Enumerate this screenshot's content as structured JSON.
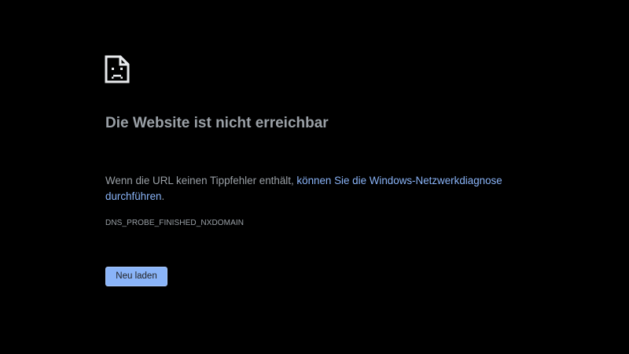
{
  "error": {
    "icon": "sad-document-icon",
    "title": "Die Website ist nicht erreichbar",
    "message_prefix": "Wenn die URL keinen Tippfehler enthält, ",
    "diagnose_link": "können Sie die Windows-Netzwerkdiagnose durchführen",
    "message_suffix": ".",
    "code": "DNS_PROBE_FINISHED_NXDOMAIN"
  },
  "actions": {
    "reload_label": "Neu laden"
  },
  "colors": {
    "background": "#000000",
    "text": "#9aa0a6",
    "link": "#8ab4f8",
    "button_bg": "#8ab4f8",
    "button_text": "#202124"
  }
}
